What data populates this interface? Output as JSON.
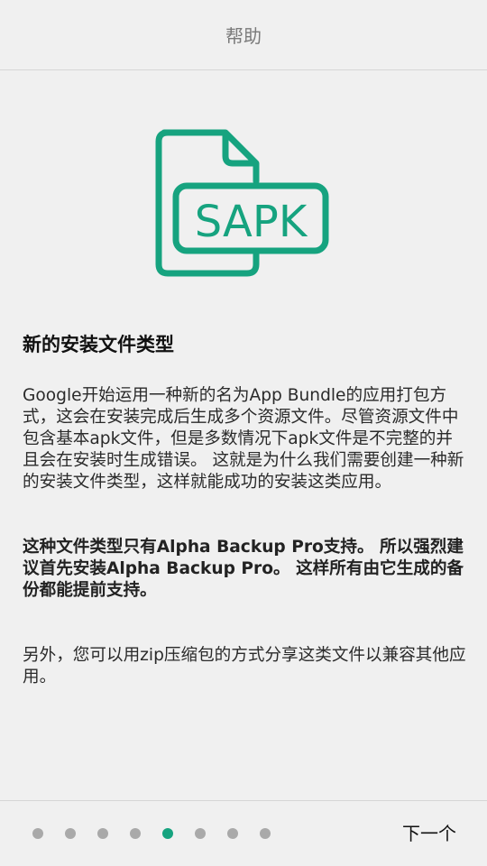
{
  "header": {
    "title": "帮助"
  },
  "logo": {
    "text": "SAPK",
    "color": "#16a37f"
  },
  "content": {
    "heading": "新的安装文件类型",
    "paragraph1": "Google开始运用一种新的名为App Bundle的应用打包方式，这会在安装完成后生成多个资源文件。尽管资源文件中包含基本apk文件，但是多数情况下apk文件是不完整的并且会在安装时生成错误。 这就是为什么我们需要创建一种新的安装文件类型，这样就能成功的安装这类应用。",
    "paragraph2": "这种文件类型只有Alpha Backup Pro支持。 所以强烈建议首先安装Alpha Backup Pro。 这样所有由它生成的备份都能提前支持。",
    "paragraph3": "另外，您可以用zip压缩包的方式分享这类文件以兼容其他应用。"
  },
  "pager": {
    "total": 8,
    "current": 5,
    "active_color": "#16a37f",
    "inactive_color": "#a9a9a9",
    "next_label": "下一个"
  }
}
